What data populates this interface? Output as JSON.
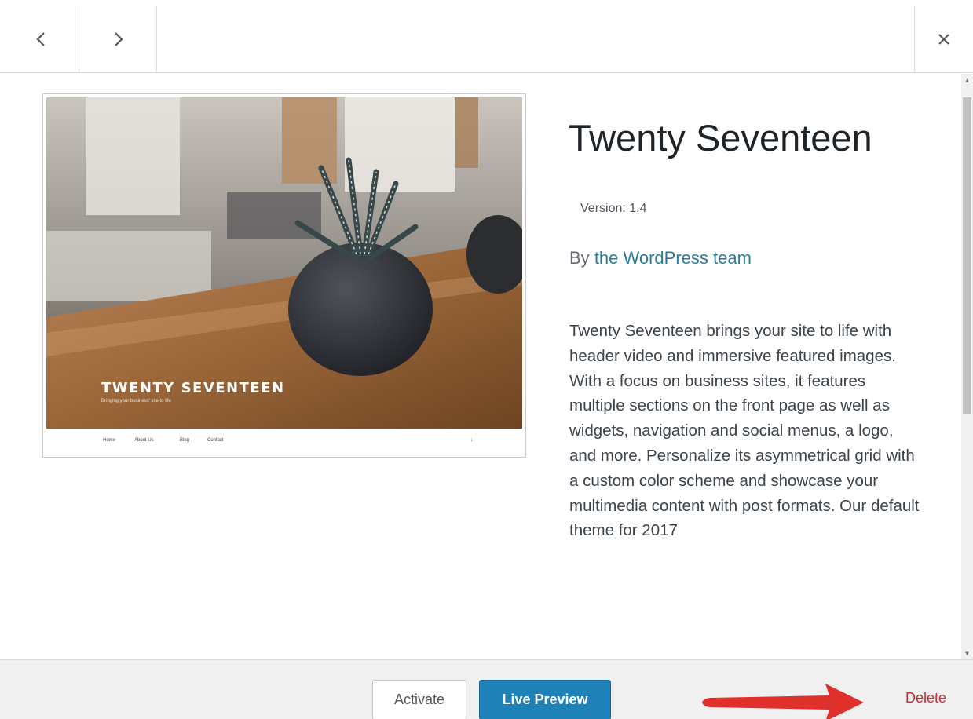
{
  "header": {
    "prev_icon": "chevron-left-icon",
    "next_icon": "chevron-right-icon",
    "close_icon": "close-icon"
  },
  "screenshot": {
    "site_title": "TWENTY SEVENTEEN",
    "site_tagline": "Bringing your business' site to life",
    "nav_items": [
      "Home",
      "About Us",
      "Blog",
      "Contact"
    ]
  },
  "theme": {
    "name": "Twenty Seventeen",
    "version_label": "Version: 1.4",
    "author_prefix": "By",
    "author_name": "the WordPress team",
    "description": "Twenty Seventeen brings your site to life with header video and immersive featured images. With a focus on business sites, it features multiple sections on the front page as well as widgets, navigation and social menus, a logo, and more. Personalize its asymmetrical grid with a custom color scheme and showcase your multimedia content with post formats. Our default theme for 2017"
  },
  "footer": {
    "activate_label": "Activate",
    "live_preview_label": "Live Preview",
    "delete_label": "Delete"
  },
  "colors": {
    "accent_blue": "#1e81b8",
    "delete_red": "#cc2a32",
    "annotation_arrow": "#e0302c"
  }
}
